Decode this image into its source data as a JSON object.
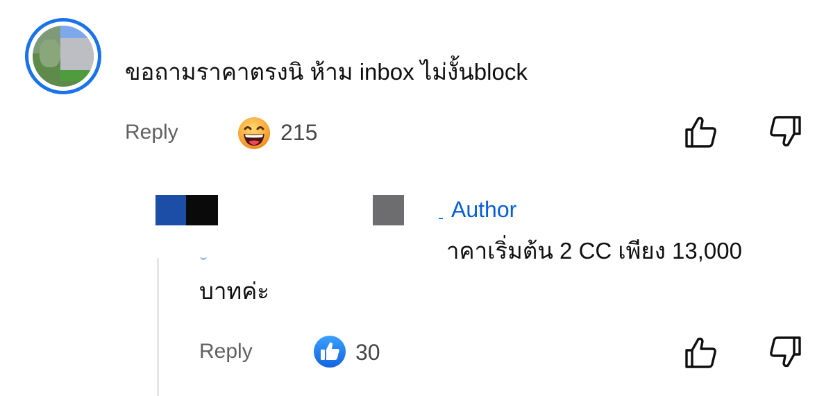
{
  "comment": {
    "text": "ขอถามราคาตรงนิ ห้าม inbox ไม่งั้นblock",
    "reply_label": "Reply",
    "reaction_icon": "grinning-face-emoji",
    "reaction_count": "215",
    "like_icon": "thumb-up-outline-icon",
    "dislike_icon": "thumb-down-outline-icon"
  },
  "reply": {
    "author_badge": "Author",
    "text_line1": "าคาเริ่มต้น 2 CC เพียง 13,000",
    "text_line2": "บาทค่ะ",
    "reply_label": "Reply",
    "reaction_icon": "thumb-up-badge-icon",
    "reaction_count": "30",
    "like_icon": "thumb-up-outline-icon",
    "dislike_icon": "thumb-down-outline-icon"
  },
  "colors": {
    "accent_blue": "#065fd4",
    "ring_blue": "#1a73e8",
    "muted_text": "#606060",
    "text": "#0f0f0f"
  }
}
